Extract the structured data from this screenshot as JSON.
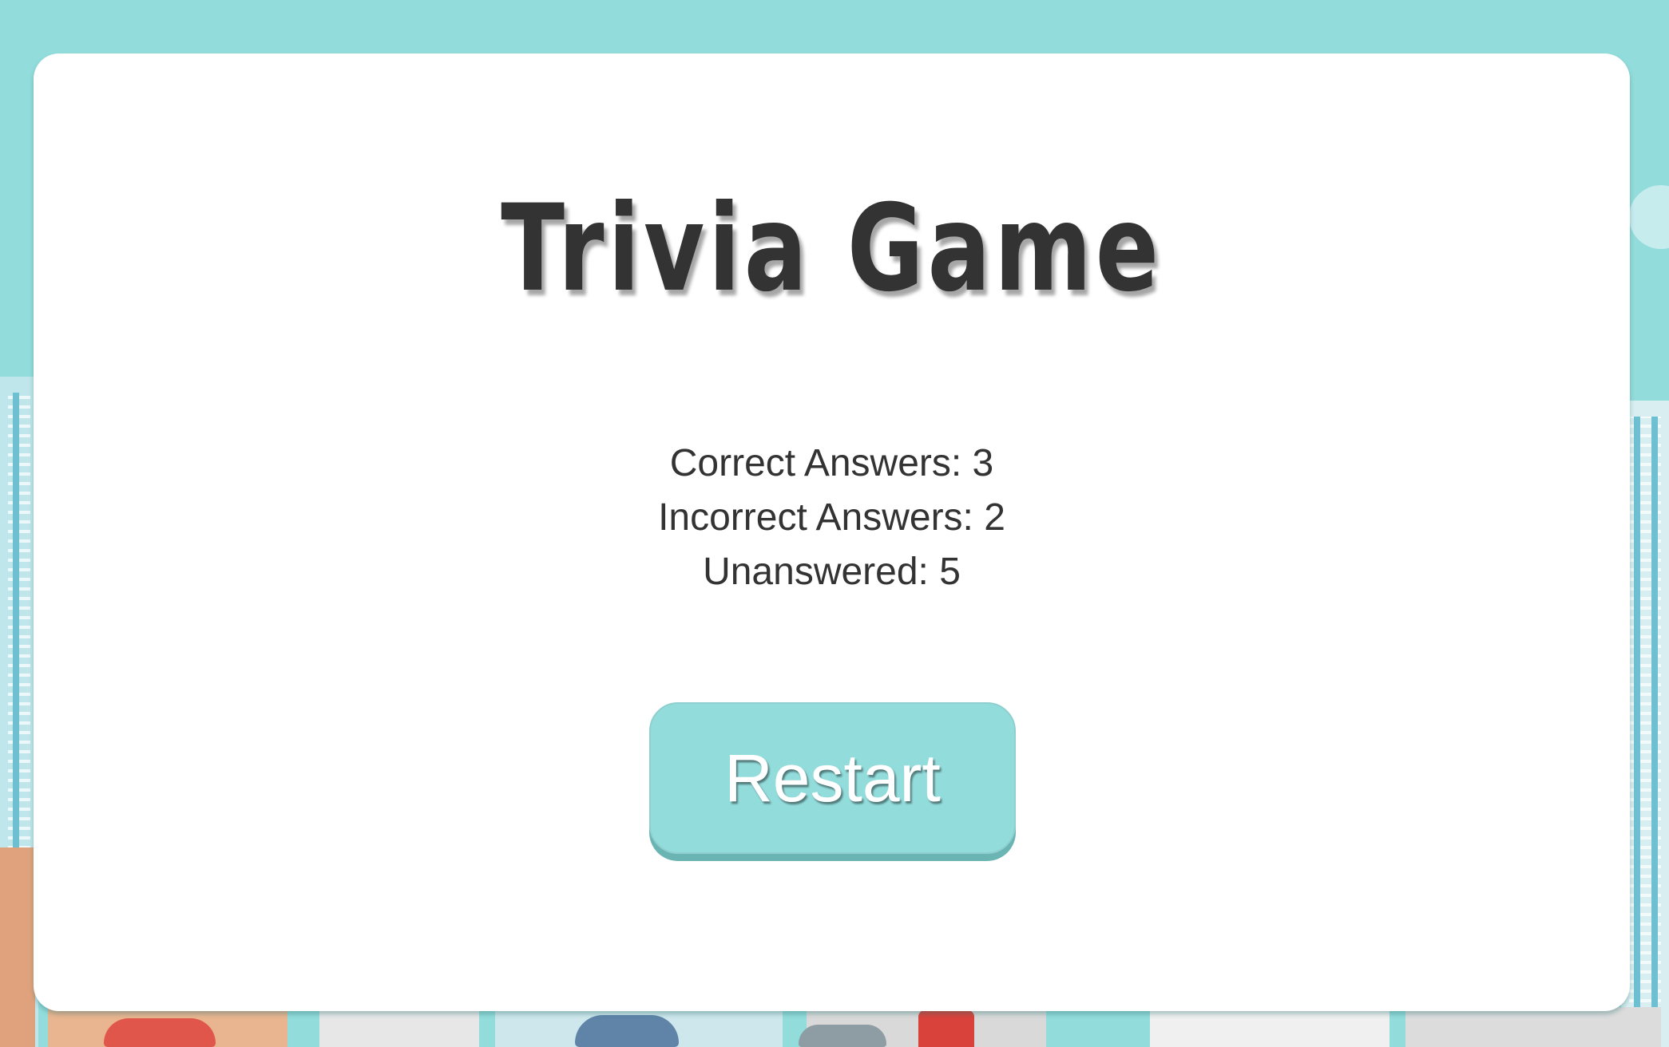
{
  "game": {
    "title": "Trivia Game",
    "results": {
      "correct_label": "Correct Answers: 3",
      "incorrect_label": "Incorrect Answers: 2",
      "unanswered_label": "Unanswered: 5",
      "correct": 3,
      "incorrect": 2,
      "unanswered": 5
    },
    "restart_label": "Restart"
  },
  "colors": {
    "background": "#93dcdc",
    "card": "#ffffff",
    "title_text": "#333333",
    "button": "#93dcdc",
    "button_text": "#ffffff"
  },
  "scene": {
    "description_icon": "city-skyline-background"
  }
}
